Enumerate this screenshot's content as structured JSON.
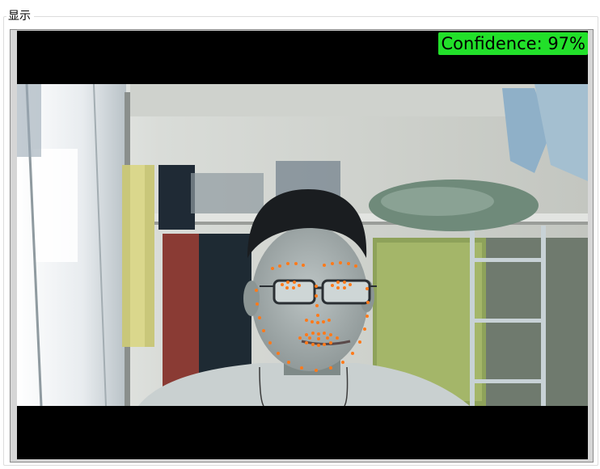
{
  "group": {
    "title": "显示"
  },
  "video": {
    "confidence_label": "Confidence: 97%"
  },
  "colors": {
    "badge_bg": "#22e02a",
    "landmark_dot": "#ff7a1a",
    "frame_border": "#8a8a8a"
  },
  "icons": {
    "landmarks": "face-landmark-dots"
  }
}
